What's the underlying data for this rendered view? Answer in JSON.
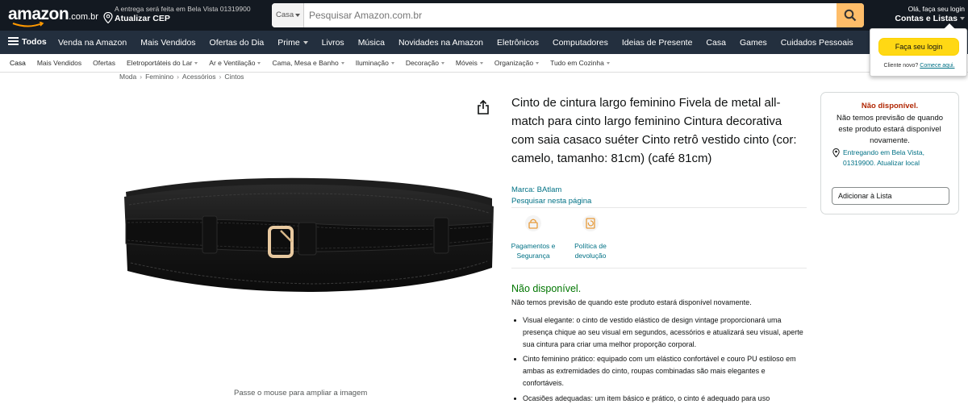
{
  "header": {
    "logo_text": "amazon",
    "logo_suffix": ".com.br",
    "deliver_line1": "A entrega será feita em Bela Vista 01319900",
    "deliver_line2": "Atualizar CEP",
    "search_category": "Casa",
    "search_placeholder": "Pesquisar Amazon.com.br",
    "account_line1": "Olá, faça seu login",
    "account_line2": "Contas e Listas",
    "colors": {
      "nav_dark": "#131921",
      "nav_main": "#232f3e",
      "search_button": "#febd69"
    }
  },
  "nav_main": {
    "all_label": "Todos",
    "links": [
      "Venda na Amazon",
      "Mais Vendidos",
      "Ofertas do Dia",
      "Prime",
      "Livros",
      "Música",
      "Novidades na Amazon",
      "Eletrônicos",
      "Computadores",
      "Ideias de Presente",
      "Casa",
      "Games",
      "Cuidados Pessoais"
    ]
  },
  "nav_sub": {
    "items": [
      "Casa",
      "Mais Vendidos",
      "Ofertas",
      "Eletroportáteis do Lar",
      "Ar e Ventilação",
      "Cama, Mesa e Banho",
      "Iluminação",
      "Decoração",
      "Móveis",
      "Organização",
      "Tudo em Cozinha"
    ]
  },
  "signin_flyout": {
    "button_label": "Faça seu login",
    "new_customer": "Cliente novo?",
    "start_here": "Comece aqui."
  },
  "breadcrumb": [
    "Moda",
    "Feminino",
    "Acessórios",
    "Cintos"
  ],
  "product": {
    "title": "Cinto de cintura largo feminino Fivela de metal all-match para cinto largo feminino Cintura decorativa com saia casaco suéter Cinto retrô vestido cinto (cor: camelo, tamanho: 81cm) (café 81cm)",
    "brand": "Marca: BAtlam",
    "search_this_page": "Pesquisar nesta página",
    "zoom_hint": "Passe o mouse para ampliar a imagem",
    "features": [
      {
        "label": "Pagamentos e Segurança",
        "icon": "secure-payment-icon"
      },
      {
        "label": "Política de devolução",
        "icon": "return-policy-icon"
      }
    ],
    "availability": "Não disponível.",
    "availability_note": "Não temos previsão de quando este produto estará disponível novamente.",
    "bullets": [
      "Visual elegante: o cinto de vestido elástico de design vintage proporcionará uma presença chique ao seu visual em segundos, acessórios e atualizará seu visual, aperte sua cintura para criar uma melhor proporção corporal.",
      "Cinto feminino prático: equipado com um elástico confortável e couro PU estiloso em ambas as extremidades do cinto, roupas combinadas são mais elegantes e confortáveis.",
      "Ocasiões adequadas: um item básico e prático, o cinto é adequado para uso"
    ]
  },
  "buybox": {
    "status": "Não disponível.",
    "note": "Não temos previsão de quando este produto estará disponível novamente.",
    "delivery": "Entregando em Bela Vista, 01319900. Atualizar local",
    "add_to_list": "Adicionar à Lista"
  }
}
